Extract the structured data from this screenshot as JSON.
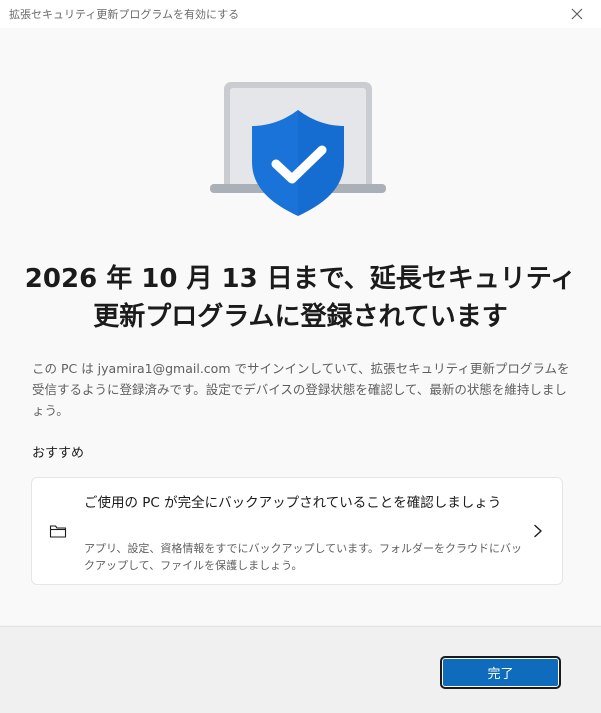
{
  "window": {
    "title": "拡張セキュリティ更新プログラムを有効にする",
    "close_icon": "close-icon"
  },
  "hero": {
    "icons": [
      "laptop-icon",
      "shield-check-icon"
    ],
    "colors": {
      "laptop_frame": "#c9cdd2",
      "laptop_screen": "#e4e6ea",
      "shield": "#1a73d9",
      "check": "#ffffff"
    }
  },
  "main": {
    "headline": "2026 年 10 月 13 日まで、延長セキュリティ更新プログラムに登録されています",
    "description": "この PC は jyamira1@gmail.com でサインインしていて、拡張セキュリティ更新プログラムを受信するように登録済みです。設定でデバイスの登録状態を確認して、最新の状態を維持しましょう。",
    "recommended_heading": "おすすめ"
  },
  "card": {
    "icon": "folder-icon",
    "title": "ご使用の PC が完全にバックアップされていることを確認しましょう",
    "subtitle": "アプリ、設定、資格情報をすでにバックアップしています。フォルダーをクラウドにバックアップして、ファイルを保護しましょう。",
    "chevron": "chevron-right-icon"
  },
  "footer": {
    "done_label": "完了",
    "accent": "#0f6cbd"
  }
}
